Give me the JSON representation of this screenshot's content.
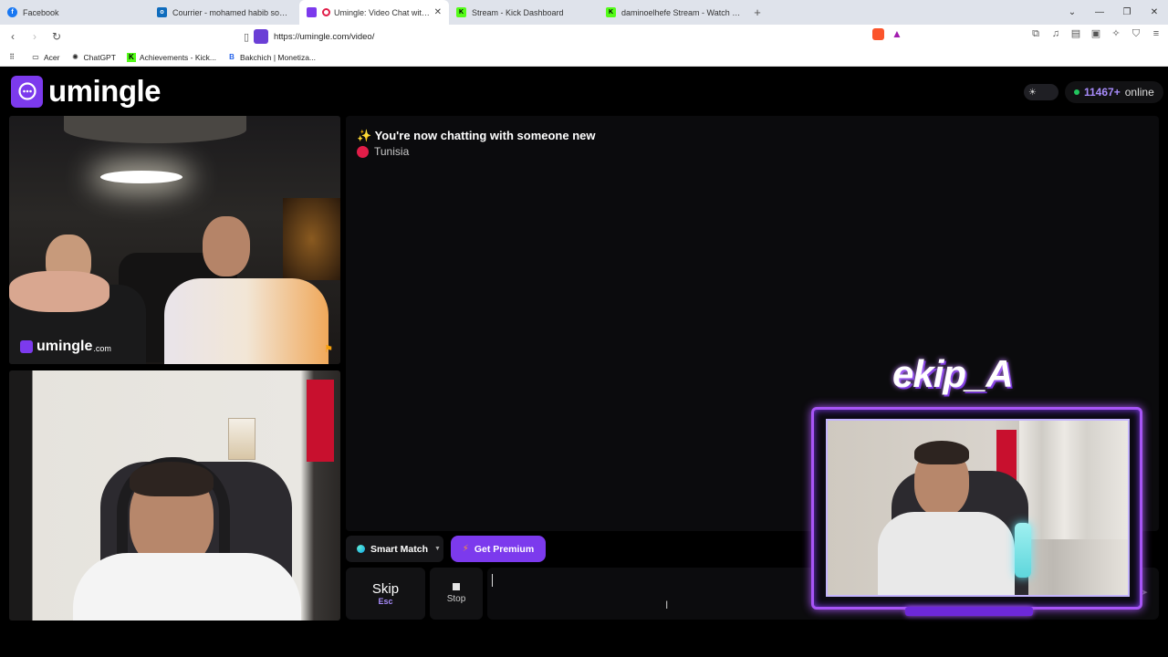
{
  "browser": {
    "tabs": [
      {
        "label": "Facebook",
        "icon": "facebook-icon",
        "color": "#1877f2",
        "active": false
      },
      {
        "label": "Courrier - mohamed habib souaied -",
        "icon": "outlook-icon",
        "color": "#0f6cbd",
        "active": false
      },
      {
        "label": "Umingle: Video Chat with Str",
        "icon": "umingle-icon",
        "color": "#7c3aed",
        "active": true
      },
      {
        "label": "Stream - Kick Dashboard",
        "icon": "kick-icon",
        "color": "#53fc18",
        "active": false
      },
      {
        "label": "daminoelhefe Stream - Watch Live o",
        "icon": "kick-icon",
        "color": "#53fc18",
        "active": false
      }
    ],
    "new_tab": "+",
    "url": "https://umingle.com/video/",
    "bookmarks": [
      {
        "label": "Acer",
        "icon": "folder-icon"
      },
      {
        "label": "ChatGPT",
        "icon": "chatgpt-icon"
      },
      {
        "label": "Achievements - Kick...",
        "icon": "kick-icon"
      },
      {
        "label": "Bakchich | Monetiza...",
        "icon": "bakchich-icon"
      }
    ]
  },
  "site": {
    "logo": "umingle",
    "online_count": "11467+",
    "online_label": "online",
    "watermark": "umingle",
    "watermark_suffix": ".com"
  },
  "chat": {
    "header": "You're now chatting with someone new",
    "header_emoji": "✨",
    "country": "Tunisia"
  },
  "controls": {
    "smart_match": "Smart Match",
    "get_premium": "Get Premium",
    "skip_label": "Skip",
    "skip_key": "Esc",
    "stop_label": "Stop",
    "message_value": ""
  },
  "overlay": {
    "title": "ekip_A"
  },
  "colors": {
    "accent": "#7c3aed",
    "online_dot": "#22c55e",
    "online_count": "#a78bfa"
  }
}
